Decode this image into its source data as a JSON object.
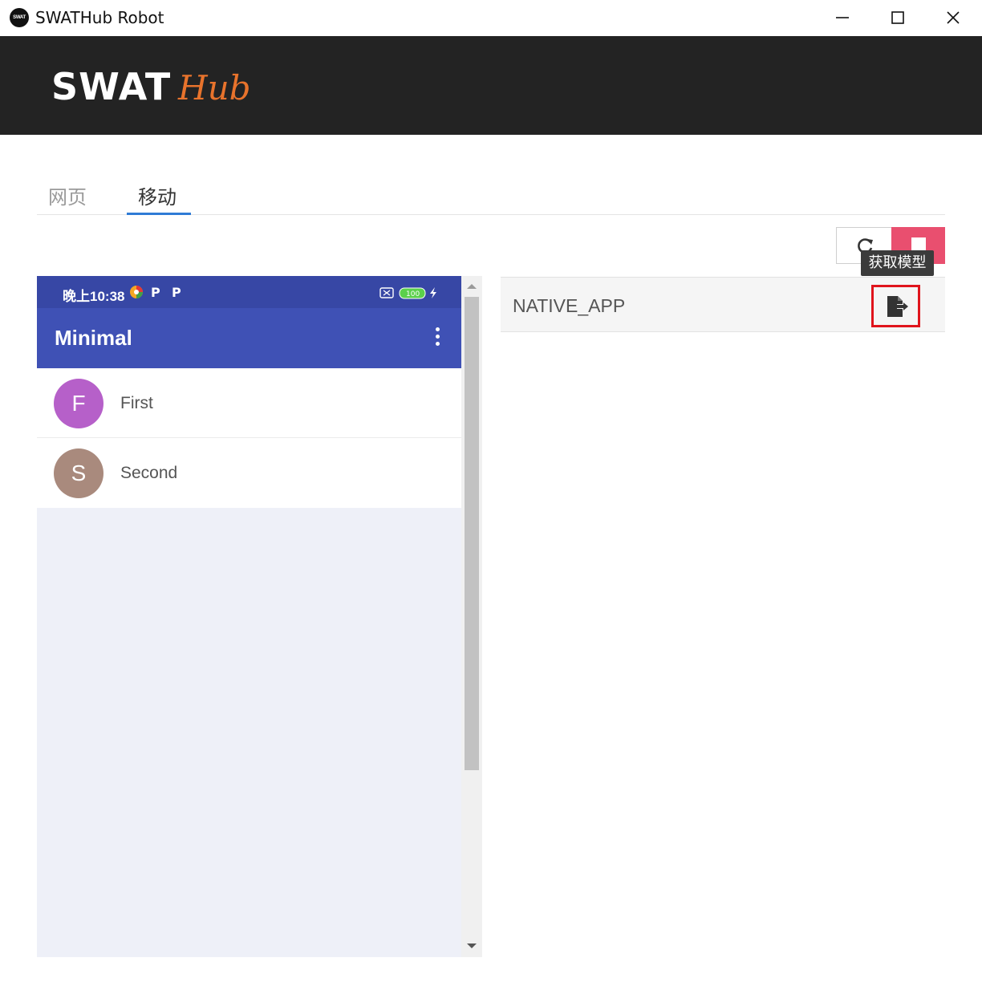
{
  "window": {
    "title": "SWATHub Robot",
    "icon_text": "SWAT",
    "controls": [
      "minimize",
      "maximize",
      "close"
    ]
  },
  "banner": {
    "logo_primary": "SWAT",
    "logo_secondary": "Hub",
    "accent_color": "#e8732c",
    "background": "#232323"
  },
  "tabs": [
    {
      "label": "网页",
      "active": false
    },
    {
      "label": "移动",
      "active": true
    }
  ],
  "toolbar": {
    "refresh_icon": "refresh-icon",
    "stop_icon": "stop-icon",
    "tooltip": "获取模型"
  },
  "phone": {
    "status_time": "晚上10:38",
    "battery": "100",
    "app_title": "Minimal",
    "items": [
      {
        "initial": "F",
        "label": "First",
        "color": "#b660c9"
      },
      {
        "initial": "S",
        "label": "Second",
        "color": "#a98a7d"
      }
    ]
  },
  "context": {
    "label": "NATIVE_APP",
    "action_icon": "export-file-icon"
  }
}
